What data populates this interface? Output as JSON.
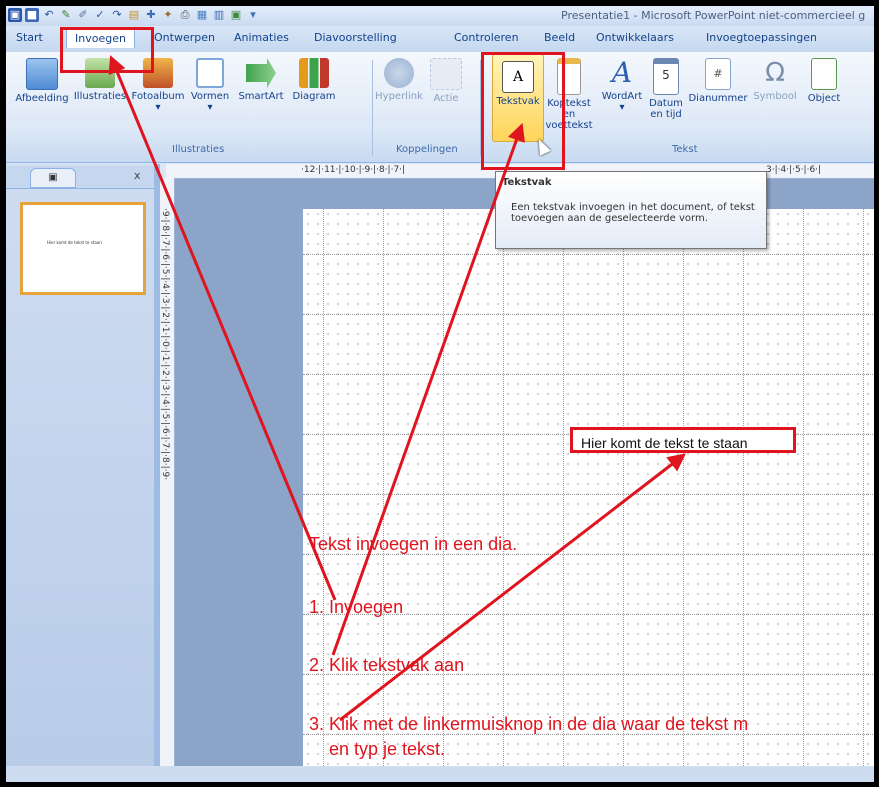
{
  "window": {
    "title": "Presentatie1 - Microsoft PowerPoint niet-commercieel g"
  },
  "tabs": [
    {
      "label": "Start"
    },
    {
      "label": "Invoegen"
    },
    {
      "label": "Ontwerpen"
    },
    {
      "label": "Animaties"
    },
    {
      "label": "Diavoorstelling"
    },
    {
      "label": "Controleren"
    },
    {
      "label": "Beeld"
    },
    {
      "label": "Ontwikkelaars"
    },
    {
      "label": "Invoegtoepassingen"
    }
  ],
  "ribbon": {
    "buttons": [
      {
        "label": "Afbeelding",
        "icon": "picture-icon",
        "color": "#4f8bd6"
      },
      {
        "label": "Illustraties",
        "icon": "clip-art-icon",
        "color": "#6aa84f"
      },
      {
        "label": "Fotoalbum",
        "icon": "photo-album-icon",
        "color": "#c0502a"
      },
      {
        "label": "Vormen",
        "icon": "shapes-icon",
        "color": "#7ea6d8"
      },
      {
        "label": "SmartArt",
        "icon": "smartart-icon",
        "color": "#3fa34d"
      },
      {
        "label": "Diagram",
        "icon": "chart-icon",
        "color": "#e39a1d"
      },
      {
        "label": "Hyperlink",
        "icon": "hyperlink-icon",
        "color": "#9ab2d4"
      },
      {
        "label": "Actie",
        "icon": "action-icon",
        "color": "#b7c8e0"
      },
      {
        "label": "Tekstvak",
        "icon": "textbox-icon",
        "color": "#f7d65a"
      },
      {
        "label": "Koptekst en voettekst",
        "icon": "header-footer-icon",
        "color": "#e8b84a"
      },
      {
        "label": "WordArt",
        "icon": "wordart-icon",
        "color": "#2f5fb0"
      },
      {
        "label": "Datum en tijd",
        "icon": "date-time-icon",
        "color": "#6d87b5"
      },
      {
        "label": "Dianummer",
        "icon": "slide-number-icon",
        "color": "#8aa4cc"
      },
      {
        "label": "Symbool",
        "icon": "omega-icon",
        "color": "#7b8ea8"
      },
      {
        "label": "Object",
        "icon": "object-icon",
        "color": "#5a9a4e"
      }
    ],
    "groups": [
      {
        "label": "Illustraties"
      },
      {
        "label": "Koppelingen"
      },
      {
        "label": "Tekst"
      }
    ]
  },
  "tooltip": {
    "title": "Tekstvak",
    "body": "Een tekstvak invoegen in het document, of tekst toevoegen aan de geselecteerde vorm."
  },
  "rulers": {
    "horizontal": "·12·|·11·|·10·|·9·|·8·|·7·|",
    "horizontal_right": "3·|·4·|·5·|·6·|",
    "vertical": "·9·|·8·|·7·|·6·|·5·|·4·|·3·|·2·|·1·|·0·|·1·|·2·|·3·|·4·|·5·|·6·|·7·|·8·|·9·"
  },
  "slide": {
    "textbox": "Hier komt de tekst te staan",
    "thumb_text": "Hier komt de tekst te staan"
  },
  "instructions": {
    "heading": "Tekst invoegen in een dia.",
    "step1": "1. Invoegen",
    "step2": "2. Klik tekstvak aan",
    "step3_line1": "3. Klik met de linkermuisknop in de dia waar de tekst m",
    "step3_line2": "en typ je tekst."
  },
  "colors": {
    "annotation_red": "#e0141e",
    "ribbon_text": "#15428b"
  }
}
